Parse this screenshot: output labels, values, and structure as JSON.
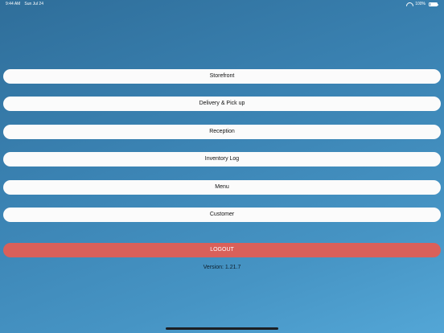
{
  "status_bar": {
    "time": "9:44 AM",
    "date": "Sun Jul 24",
    "battery": "100%"
  },
  "menu": {
    "items": [
      {
        "label": "Storefront"
      },
      {
        "label": "Delivery & Pick up"
      },
      {
        "label": "Reception"
      },
      {
        "label": "Inventory Log"
      },
      {
        "label": "Menu"
      },
      {
        "label": "Customer"
      }
    ]
  },
  "logout": {
    "label": "LOGOUT",
    "color": "#d9605a"
  },
  "version": {
    "text": "Version: 1.21.7"
  },
  "icons": [
    "wifi-icon",
    "battery-icon"
  ]
}
